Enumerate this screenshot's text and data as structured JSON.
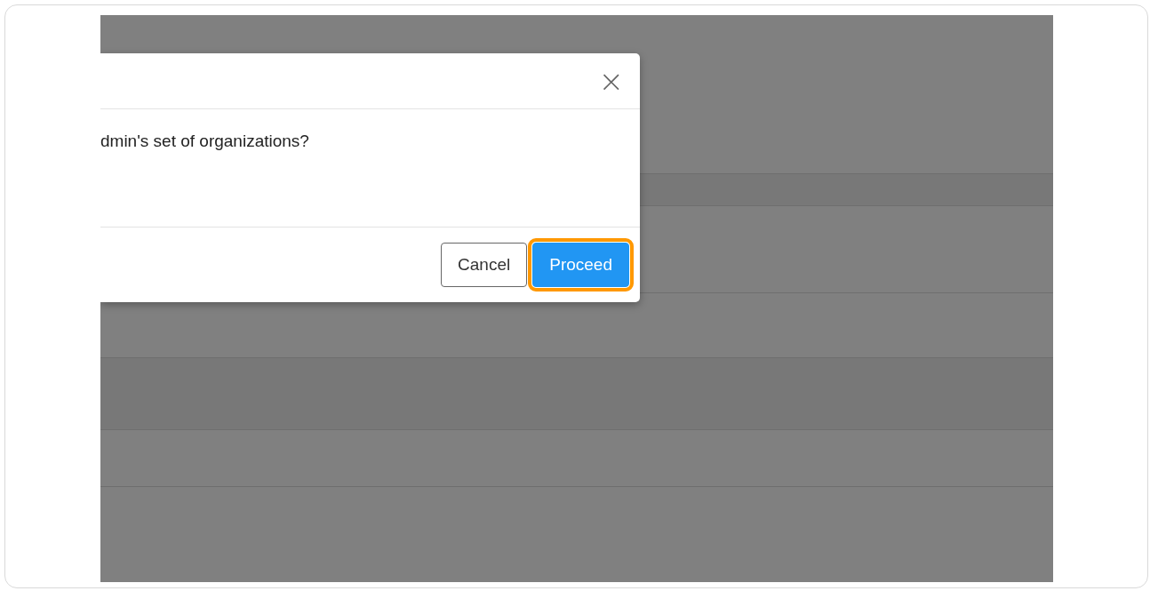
{
  "dialog": {
    "message": "dmin's set of organizations?",
    "close": "×",
    "buttons": [
      {
        "label": "Cancel",
        "kind": "secondary",
        "highlighted": false
      },
      {
        "label": "Proceed",
        "kind": "primary",
        "highlighted": true
      }
    ]
  }
}
